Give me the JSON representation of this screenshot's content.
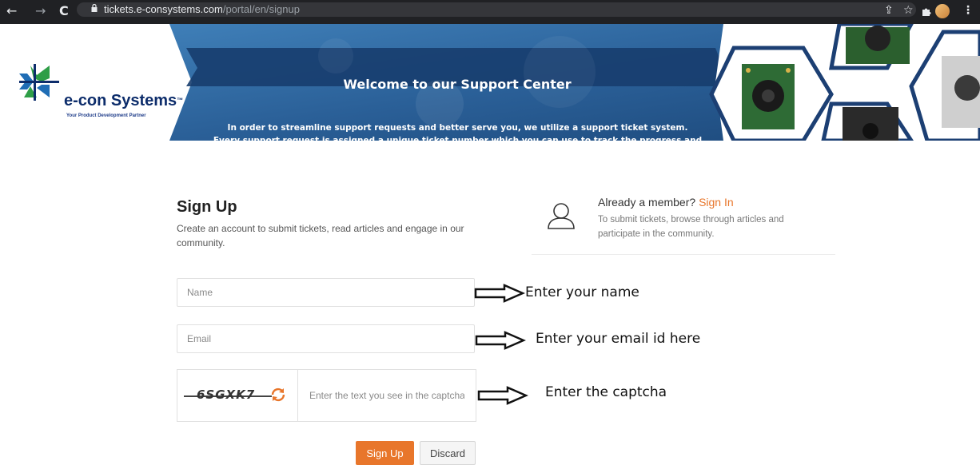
{
  "browser": {
    "url_host": "tickets.e-consystems.com",
    "url_path": "/portal/en/signup",
    "back_icon": "←",
    "forward_icon": "→",
    "reload_icon": "C",
    "share_icon": "⇪",
    "star_icon": "☆",
    "menu_icon": "⋮"
  },
  "header": {
    "logo_name": "e-con Systems",
    "logo_tm": "™",
    "logo_tagline": "Your Product Development Partner",
    "banner_title": "Welcome to our Support Center",
    "banner_line1": "In order to streamline support requests and better serve you, we utilize a support ticket system.",
    "banner_line2": "Every support request is assigned a unique ticket number which you can use to track the progress and responses online"
  },
  "signup": {
    "title": "Sign Up",
    "description": "Create an account to submit tickets, read articles and engage in our community.",
    "name_placeholder": "Name",
    "email_placeholder": "Email",
    "captcha_code": "6SGXK7",
    "captcha_placeholder": "Enter the text you see in the captcha",
    "submit_label": "Sign Up",
    "discard_label": "Discard"
  },
  "member": {
    "question": "Already a member?",
    "link": "Sign In",
    "description": "To submit tickets, browse through articles and participate in the community."
  },
  "annotations": {
    "name": "Enter your name",
    "email": "Enter your email id here",
    "captcha": "Enter the captcha"
  },
  "colors": {
    "accent": "#e8762b",
    "banner_blue": "#1f4f86",
    "browser_bg": "#202124"
  }
}
